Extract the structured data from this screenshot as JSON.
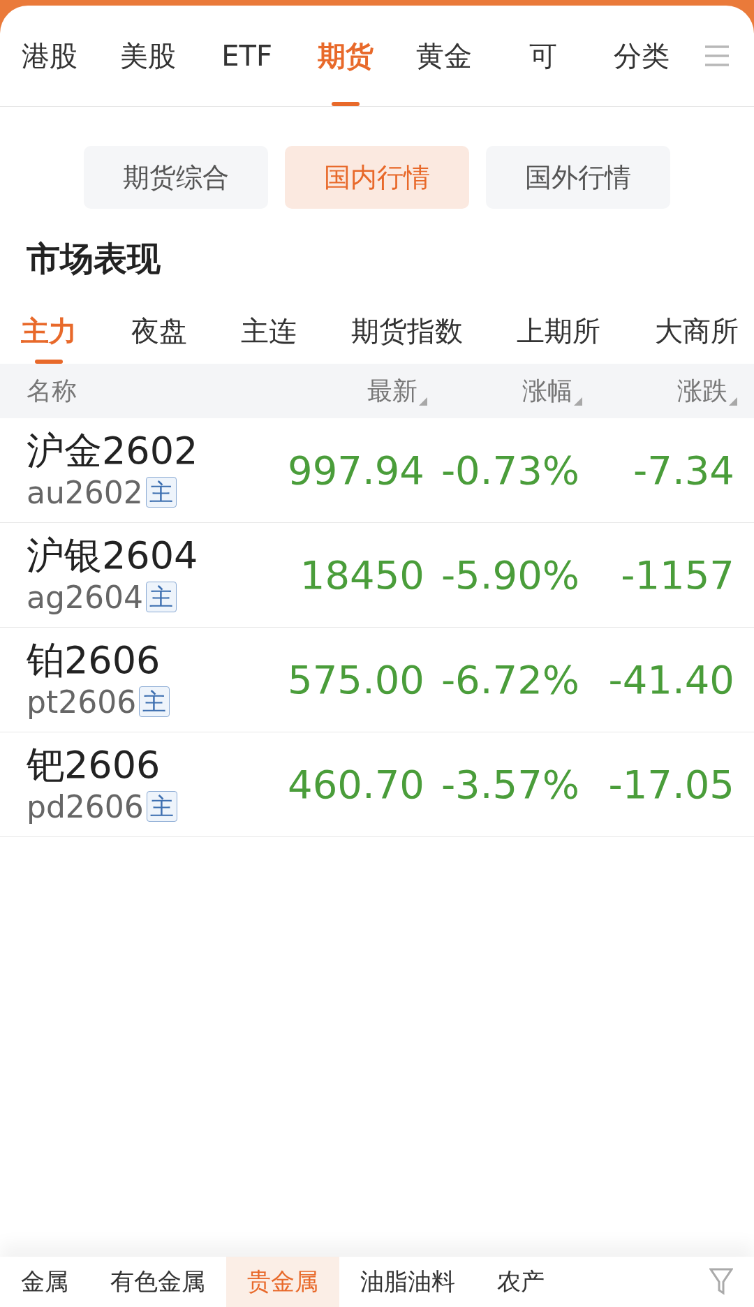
{
  "top_tabs": [
    {
      "label": "港股",
      "selected": false
    },
    {
      "label": "美股",
      "selected": false
    },
    {
      "label": "ETF",
      "selected": false
    },
    {
      "label": "期货",
      "selected": true
    },
    {
      "label": "黄金",
      "selected": false
    },
    {
      "label": "可",
      "selected": false
    }
  ],
  "category_button": "分类",
  "segments": [
    {
      "label": "期货综合",
      "selected": false
    },
    {
      "label": "国内行情",
      "selected": true
    },
    {
      "label": "国外行情",
      "selected": false
    }
  ],
  "section_title": "市场表现",
  "sub_tabs": [
    {
      "label": "主力",
      "selected": true
    },
    {
      "label": "夜盘",
      "selected": false
    },
    {
      "label": "主连",
      "selected": false
    },
    {
      "label": "期货指数",
      "selected": false
    },
    {
      "label": "上期所",
      "selected": false
    },
    {
      "label": "大商所",
      "selected": false
    }
  ],
  "table": {
    "columns": [
      {
        "label": "名称",
        "sortable": false
      },
      {
        "label": "最新",
        "sortable": true
      },
      {
        "label": "涨幅",
        "sortable": true
      },
      {
        "label": "涨跌",
        "sortable": true
      }
    ],
    "rows": [
      {
        "name": "沪金2602",
        "code": "au2602",
        "badge": "主",
        "latest": "997.94",
        "change_pct": "-0.73%",
        "change": "-7.34"
      },
      {
        "name": "沪银2604",
        "code": "ag2604",
        "badge": "主",
        "latest": "18450",
        "change_pct": "-5.90%",
        "change": "-1157"
      },
      {
        "name": "铂2606",
        "code": "pt2606",
        "badge": "主",
        "latest": "575.00",
        "change_pct": "-6.72%",
        "change": "-41.40"
      },
      {
        "name": "钯2606",
        "code": "pd2606",
        "badge": "主",
        "latest": "460.70",
        "change_pct": "-3.57%",
        "change": "-17.05"
      }
    ]
  },
  "bottom_tabs": [
    {
      "label": "金属",
      "selected": false
    },
    {
      "label": "有色金属",
      "selected": false
    },
    {
      "label": "贵金属",
      "selected": true
    },
    {
      "label": "油脂油料",
      "selected": false
    },
    {
      "label": "农产",
      "selected": false
    }
  ]
}
